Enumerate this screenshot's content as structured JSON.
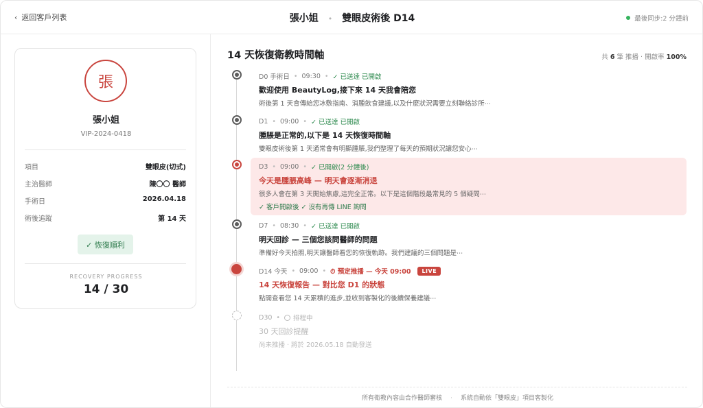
{
  "header": {
    "back_label": "返回客戶列表",
    "patient_name": "張小姐",
    "procedure_title": "雙眼皮術後 D14",
    "sync_status": "最後同步:2 分鐘前"
  },
  "patient": {
    "avatar_char": "張",
    "name": "張小姐",
    "id": "VIP-2024-0418",
    "rows": [
      {
        "label": "項目",
        "value": "雙眼皮(切式)"
      },
      {
        "label": "主治醫師",
        "value": "陳〇〇 醫師"
      },
      {
        "label": "手術日",
        "value": "2026.04.18"
      },
      {
        "label": "術後追蹤",
        "value": "第 14 天"
      }
    ],
    "status": "✓ 恢復順利",
    "progress_label": "RECOVERY PROGRESS",
    "progress_value": "14 / 30"
  },
  "timeline": {
    "title": "14 天恢復衛教時間軸",
    "summary_prefix": "共",
    "summary_count": "6",
    "summary_mid": "筆 推播 · 開啟率",
    "summary_rate": "100%",
    "entries": [
      {
        "day": "D0 手術日",
        "time": "09:30",
        "status": "✓ 已送達 已開啟",
        "title": "歡迎使用 BeautyLog,接下來 14 天我會陪您",
        "desc": "術後第 1 天會傳給您冰敷指南、消腫飲食建議,以及什麼狀況需要立刻聯絡診所⋯"
      },
      {
        "day": "D1",
        "time": "09:00",
        "status": "✓ 已送達 已開啟",
        "title": "腫脹是正常的,以下是 14 天恢復時間軸",
        "desc": "雙眼皮術後第 1 天通常會有明顯腫脹,我們整理了每天的預期狀況讓您安心⋯"
      },
      {
        "day": "D3",
        "time": "09:00",
        "status": "✓ 已開啟(2 分鐘後)",
        "title": "今天是腫脹高峰 — 明天會逐漸消退",
        "desc": "很多人會在第 3 天開始焦慮,這完全正常。以下是這個階段最常見的 5 個疑問⋯",
        "note": "✓ 客戶開啟後 ✓ 沒有再傳 LINE 詢問"
      },
      {
        "day": "D7",
        "time": "08:30",
        "status": "✓ 已送達 已開啟",
        "title": "明天回診 — 三個您該問醫師的問題",
        "desc": "準備好今天拍照,明天讓醫師看您的恢復軌跡。我們建議的三個問題是⋯"
      },
      {
        "day": "D14 今天",
        "time": "09:00",
        "status": "⏱ 預定推播 — 今天 09:00",
        "badge": "LIVE",
        "title": "14 天恢復報告 — 對比您 D1 的狀態",
        "desc": "點開查看您 14 天累積的進步,並收到客製化的後續保養建議⋯"
      },
      {
        "day": "D30",
        "status": "排程中",
        "title": "30 天回診提醒",
        "desc": "尚未推播 · 將於 2026.05.18 自動發送"
      }
    ]
  },
  "footer": {
    "left": "所有衛教內容由合作醫師審核",
    "right": "系統自動依「雙眼皮」項目客製化"
  },
  "colors": {
    "accent_red": "#c9453e",
    "success_green": "#2d8a4e",
    "highlight_bg": "#fde8e8"
  }
}
